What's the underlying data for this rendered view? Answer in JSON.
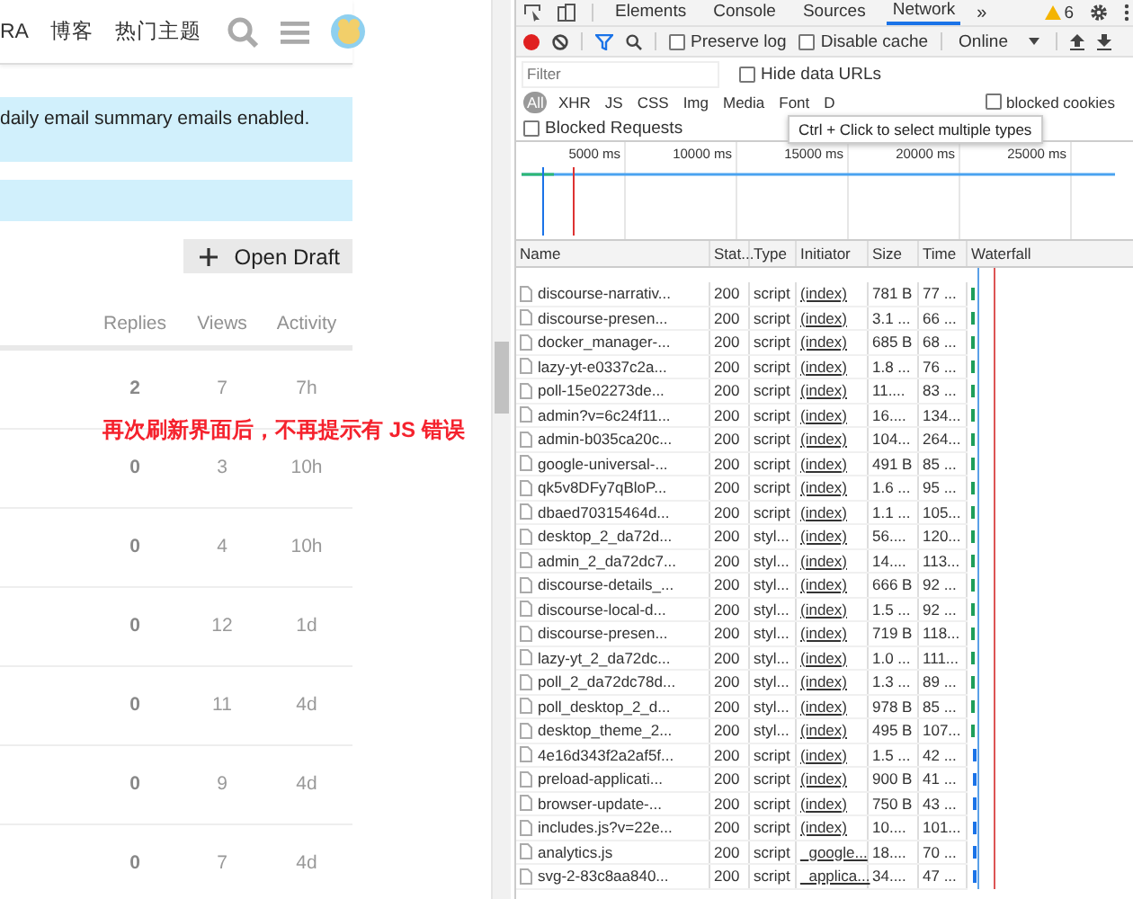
{
  "site": {
    "nav": [
      "RA",
      "博客",
      "热门主题"
    ],
    "notice": "daily email summary emails enabled.",
    "open_draft_button": "Open Draft",
    "topic_columns": [
      "Replies",
      "Views",
      "Activity"
    ],
    "topics": [
      {
        "replies": "2",
        "views": "7",
        "activity": "7h"
      },
      {
        "replies": "0",
        "views": "3",
        "activity": "10h"
      },
      {
        "replies": "0",
        "views": "4",
        "activity": "10h"
      },
      {
        "replies": "0",
        "views": "12",
        "activity": "1d"
      },
      {
        "replies": "0",
        "views": "11",
        "activity": "4d"
      },
      {
        "replies": "0",
        "views": "9",
        "activity": "4d"
      },
      {
        "replies": "0",
        "views": "7",
        "activity": "4d"
      }
    ],
    "annotation": "再次刷新界面后，不再提示有 JS 错误"
  },
  "devtools": {
    "tabs": [
      {
        "label": "Elements",
        "selected": false
      },
      {
        "label": "Console",
        "selected": false
      },
      {
        "label": "Sources",
        "selected": false
      },
      {
        "label": "Network",
        "selected": true
      }
    ],
    "more": "»",
    "warnings": "6",
    "preserve_log": {
      "label": "Preserve log",
      "checked": false
    },
    "disable_cache": {
      "label": "Disable cache",
      "checked": false
    },
    "throttling": "Online",
    "filter": {
      "placeholder": "Filter"
    },
    "hide_data_urls": {
      "label": "Hide data URLs",
      "checked": false
    },
    "types": [
      {
        "label": "All",
        "selected": true
      },
      {
        "label": "XHR",
        "selected": false
      },
      {
        "label": "JS",
        "selected": false
      },
      {
        "label": "CSS",
        "selected": false
      },
      {
        "label": "Img",
        "selected": false
      },
      {
        "label": "Media",
        "selected": false
      },
      {
        "label": "Font",
        "selected": false
      },
      {
        "label": "D",
        "selected": false
      }
    ],
    "blocked_cookies": {
      "label": "blocked cookies",
      "checked": false
    },
    "blocked_requests": {
      "label": "Blocked Requests",
      "checked": false
    },
    "tooltip": "Ctrl + Click to select multiple types",
    "overview_ticks": [
      "5000 ms",
      "10000 ms",
      "15000 ms",
      "20000 ms",
      "25000 ms"
    ],
    "columns": [
      "Name",
      "Stat...",
      "Type",
      "Initiator",
      "Size",
      "Time",
      "Waterfall"
    ],
    "requests": [
      {
        "name": "discourse-narrativ...",
        "status": "200",
        "type": "script",
        "initiator": "(index)",
        "size": "781 B",
        "time": "77 ..."
      },
      {
        "name": "discourse-presen...",
        "status": "200",
        "type": "script",
        "initiator": "(index)",
        "size": "3.1 ...",
        "time": "66 ..."
      },
      {
        "name": "docker_manager-...",
        "status": "200",
        "type": "script",
        "initiator": "(index)",
        "size": "685 B",
        "time": "68 ..."
      },
      {
        "name": "lazy-yt-e0337c2a...",
        "status": "200",
        "type": "script",
        "initiator": "(index)",
        "size": "1.8 ...",
        "time": "76 ..."
      },
      {
        "name": "poll-15e02273de...",
        "status": "200",
        "type": "script",
        "initiator": "(index)",
        "size": "11....",
        "time": "83 ..."
      },
      {
        "name": "admin?v=6c24f11...",
        "status": "200",
        "type": "script",
        "initiator": "(index)",
        "size": "16....",
        "time": "134..."
      },
      {
        "name": "admin-b035ca20c...",
        "status": "200",
        "type": "script",
        "initiator": "(index)",
        "size": "104...",
        "time": "264..."
      },
      {
        "name": "google-universal-...",
        "status": "200",
        "type": "script",
        "initiator": "(index)",
        "size": "491 B",
        "time": "85 ..."
      },
      {
        "name": "qk5v8DFy7qBloP...",
        "status": "200",
        "type": "script",
        "initiator": "(index)",
        "size": "1.6 ...",
        "time": "95 ..."
      },
      {
        "name": "dbaed70315464d...",
        "status": "200",
        "type": "script",
        "initiator": "(index)",
        "size": "1.1 ...",
        "time": "105..."
      },
      {
        "name": "desktop_2_da72d...",
        "status": "200",
        "type": "styl...",
        "initiator": "(index)",
        "size": "56....",
        "time": "120..."
      },
      {
        "name": "admin_2_da72dc7...",
        "status": "200",
        "type": "styl...",
        "initiator": "(index)",
        "size": "14....",
        "time": "113..."
      },
      {
        "name": "discourse-details_...",
        "status": "200",
        "type": "styl...",
        "initiator": "(index)",
        "size": "666 B",
        "time": "92 ..."
      },
      {
        "name": "discourse-local-d...",
        "status": "200",
        "type": "styl...",
        "initiator": "(index)",
        "size": "1.5 ...",
        "time": "92 ..."
      },
      {
        "name": "discourse-presen...",
        "status": "200",
        "type": "styl...",
        "initiator": "(index)",
        "size": "719 B",
        "time": "118..."
      },
      {
        "name": "lazy-yt_2_da72dc...",
        "status": "200",
        "type": "styl...",
        "initiator": "(index)",
        "size": "1.0 ...",
        "time": "111..."
      },
      {
        "name": "poll_2_da72dc78d...",
        "status": "200",
        "type": "styl...",
        "initiator": "(index)",
        "size": "1.3 ...",
        "time": "89 ..."
      },
      {
        "name": "poll_desktop_2_d...",
        "status": "200",
        "type": "styl...",
        "initiator": "(index)",
        "size": "978 B",
        "time": "85 ..."
      },
      {
        "name": "desktop_theme_2...",
        "status": "200",
        "type": "styl...",
        "initiator": "(index)",
        "size": "495 B",
        "time": "107..."
      },
      {
        "name": "4e16d343f2a2af5f...",
        "status": "200",
        "type": "script",
        "initiator": "(index)",
        "size": "1.5 ...",
        "time": "42 ..."
      },
      {
        "name": "preload-applicati...",
        "status": "200",
        "type": "script",
        "initiator": "(index)",
        "size": "900 B",
        "time": "41 ..."
      },
      {
        "name": "browser-update-...",
        "status": "200",
        "type": "script",
        "initiator": "(index)",
        "size": "750 B",
        "time": "43 ..."
      },
      {
        "name": "includes.js?v=22e...",
        "status": "200",
        "type": "script",
        "initiator": "(index)",
        "size": "10....",
        "time": "101..."
      },
      {
        "name": "analytics.js",
        "status": "200",
        "type": "script",
        "initiator": "_google...",
        "size": "18....",
        "time": "70 ..."
      },
      {
        "name": "svg-2-83c8aa840...",
        "status": "200",
        "type": "script",
        "initiator": "_applica...",
        "size": "34....",
        "time": "47 ..."
      }
    ]
  }
}
